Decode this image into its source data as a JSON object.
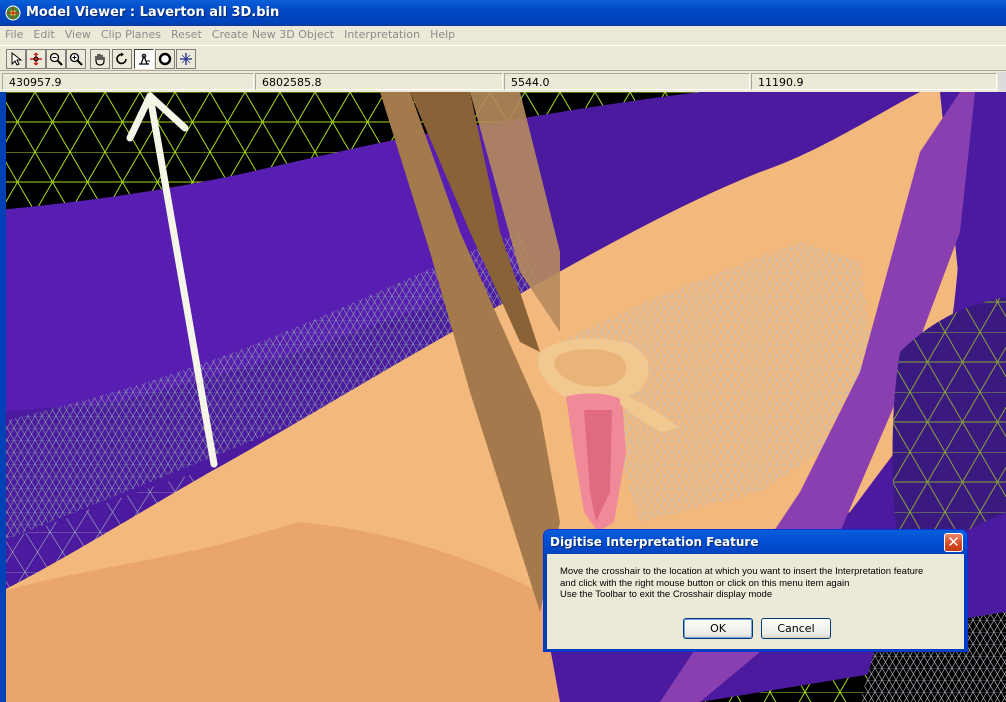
{
  "window": {
    "title": "Model Viewer : Laverton all 3D.bin"
  },
  "menu": [
    {
      "label": "File"
    },
    {
      "label": "Edit"
    },
    {
      "label": "View"
    },
    {
      "label": "Clip Planes"
    },
    {
      "label": "Reset"
    },
    {
      "label": "Create New 3D Object"
    },
    {
      "label": "Interpretation"
    },
    {
      "label": "Help"
    }
  ],
  "toolbar": {
    "tools": [
      {
        "icon": "pointer-arrow-icon"
      },
      {
        "icon": "pan-move-icon"
      },
      {
        "icon": "zoom-out-icon"
      },
      {
        "icon": "zoom-in-icon"
      },
      {
        "icon": "hand-icon"
      },
      {
        "icon": "rotate-icon"
      },
      {
        "icon": "digitise-icon",
        "pressed": true
      },
      {
        "icon": "sphere-icon"
      },
      {
        "icon": "crosshair-icon"
      }
    ]
  },
  "coords": {
    "x": "430957.9",
    "y": "6802585.8",
    "z": "5544.0",
    "scale": "11190.9"
  },
  "dialog": {
    "title": "Digitise Interpretation Feature",
    "message": [
      "Move the crosshair to the location at which you want to insert the Interpretation feature",
      "and click with the right mouse button or click on this menu item again",
      "Use the Toolbar to exit the Crosshair display mode"
    ],
    "ok_label": "OK",
    "cancel_label": "Cancel",
    "close_glyph": "✕"
  },
  "colors": {
    "titlebar": "#0149c7",
    "mesh_green": "#b4e61e",
    "surface_purple": "#4a1aa0",
    "surface_tan": "#f2b57a",
    "annotation_arrow": "#f5f5e8"
  }
}
